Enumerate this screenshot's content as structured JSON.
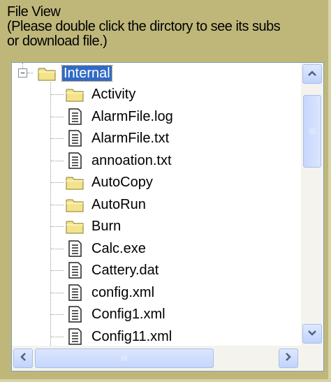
{
  "header": {
    "line1": "File View",
    "line2": "(Please double click the dirctory to see its subs",
    "line3": "or download file.)"
  },
  "tree": {
    "expander_symbol": "−",
    "root": {
      "label": "Internal",
      "type": "folder",
      "selected": true,
      "expanded": true
    },
    "children": [
      {
        "label": "Activity",
        "type": "folder"
      },
      {
        "label": "AlarmFile.log",
        "type": "file"
      },
      {
        "label": "AlarmFile.txt",
        "type": "file"
      },
      {
        "label": "annoation.txt",
        "type": "file"
      },
      {
        "label": "AutoCopy",
        "type": "folder"
      },
      {
        "label": "AutoRun",
        "type": "folder"
      },
      {
        "label": "Burn",
        "type": "folder"
      },
      {
        "label": "Calc.exe",
        "type": "file"
      },
      {
        "label": "Cattery.dat",
        "type": "file"
      },
      {
        "label": "config.xml",
        "type": "file"
      },
      {
        "label": "Config1.xml",
        "type": "file"
      },
      {
        "label": "Config11.xml",
        "type": "file"
      }
    ]
  },
  "colors": {
    "panel_bg": "#bfb77a",
    "selection": "#316ac5",
    "folder": "#f3e48c"
  },
  "icons": {
    "folder": "folder-icon",
    "file": "text-file-icon",
    "scroll_up": "chevron-up-icon",
    "scroll_down": "chevron-down-icon",
    "scroll_left": "chevron-left-icon",
    "scroll_right": "chevron-right-icon"
  }
}
